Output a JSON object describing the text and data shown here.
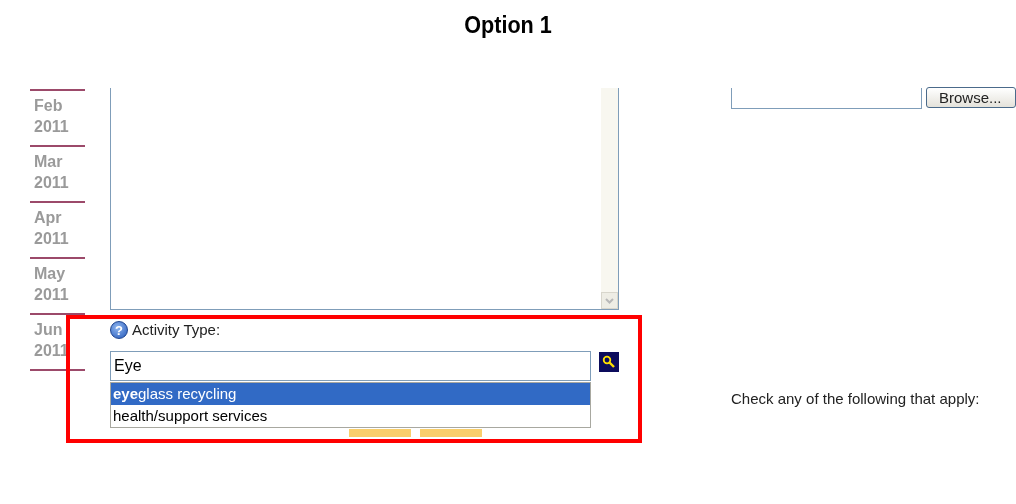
{
  "title": "Option 1",
  "months": [
    {
      "month": "Feb",
      "year": "2011"
    },
    {
      "month": "Mar",
      "year": "2011"
    },
    {
      "month": "Apr",
      "year": "2011"
    },
    {
      "month": "May",
      "year": "2011"
    },
    {
      "month": "Jun",
      "year": "2011"
    }
  ],
  "activity_type": {
    "help": "?",
    "label": "Activity Type:",
    "value": "Eye",
    "suggestions": [
      {
        "text": "**eye**glass recycling",
        "selected": true
      },
      {
        "text": "health/support services",
        "selected": false
      }
    ]
  },
  "file_upload": {
    "button": "Browse..."
  },
  "checklist_prompt": "Check any of the following that apply:"
}
